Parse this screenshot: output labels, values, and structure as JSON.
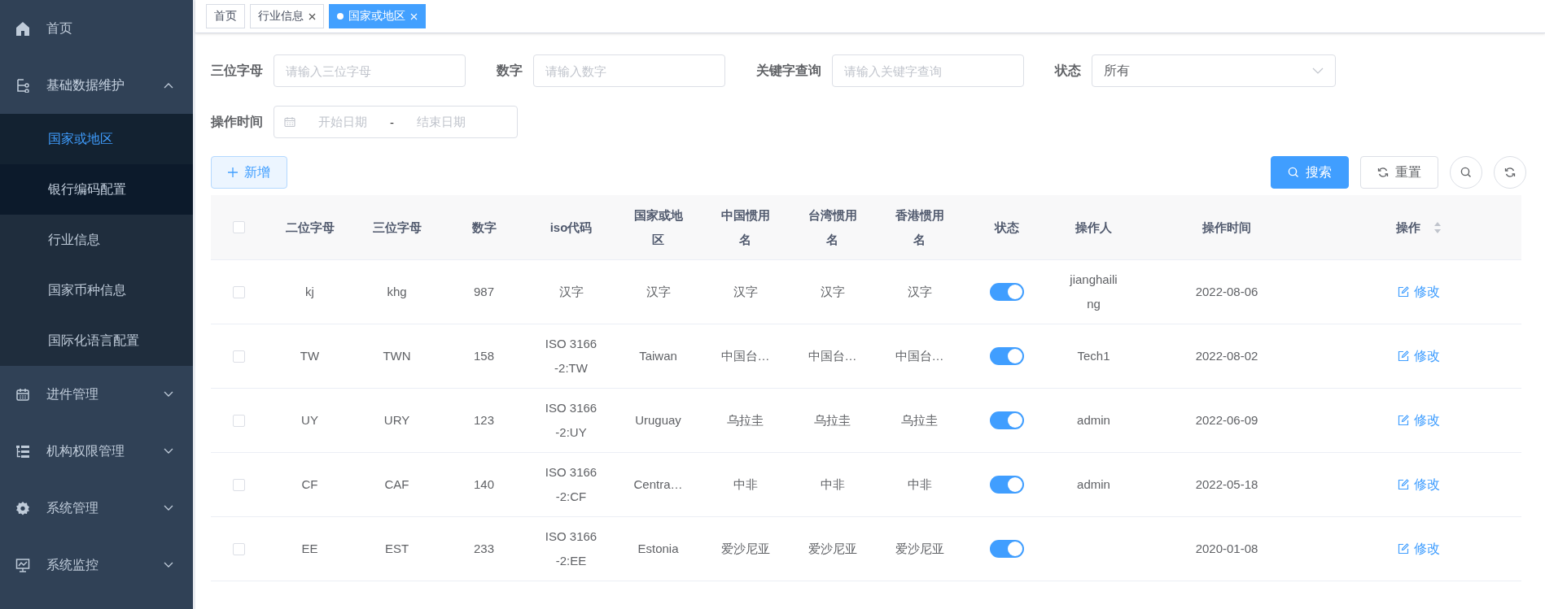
{
  "sidebar": {
    "items": [
      {
        "label": "首页"
      },
      {
        "label": "基础数据维护",
        "expanded": true,
        "children": [
          {
            "label": "国家或地区",
            "selected": true,
            "hovered": false
          },
          {
            "label": "银行编码配置",
            "selected": false,
            "hovered": true
          },
          {
            "label": "行业信息",
            "selected": false,
            "hovered": false
          },
          {
            "label": "国家币种信息",
            "selected": false,
            "hovered": false
          },
          {
            "label": "国际化语言配置",
            "selected": false,
            "hovered": false
          }
        ]
      },
      {
        "label": "进件管理",
        "expanded": false
      },
      {
        "label": "机构权限管理",
        "expanded": false
      },
      {
        "label": "系统管理",
        "expanded": false
      },
      {
        "label": "系统监控",
        "expanded": false
      }
    ]
  },
  "tabs": [
    {
      "label": "首页",
      "selected": false,
      "closable": false
    },
    {
      "label": "行业信息",
      "selected": false,
      "closable": true
    },
    {
      "label": "国家或地区",
      "selected": true,
      "closable": true
    }
  ],
  "filters": [
    {
      "label": "三位字母",
      "kind": "input",
      "placeholder": "请输入三位字母"
    },
    {
      "label": "数字",
      "kind": "input",
      "placeholder": "请输入数字"
    },
    {
      "label": "关键字查询",
      "kind": "input",
      "placeholder": "请输入关键字查询"
    },
    {
      "label": "状态",
      "kind": "select",
      "value": "所有"
    },
    {
      "label": "操作时间",
      "kind": "daterange",
      "start_placeholder": "开始日期",
      "separator": "-",
      "end_placeholder": "结束日期"
    }
  ],
  "buttons": {
    "add": "新增",
    "search": "搜索",
    "reset": "重置"
  },
  "table": {
    "all_checked": false,
    "columns": [
      {
        "label": "二位字母"
      },
      {
        "label": "三位字母"
      },
      {
        "label": "数字"
      },
      {
        "label": "iso代码"
      },
      {
        "label": "国家或地区"
      },
      {
        "label": "中国惯用名"
      },
      {
        "label": "台湾惯用名"
      },
      {
        "label": "香港惯用名"
      },
      {
        "label": "状态"
      },
      {
        "label": "操作人"
      },
      {
        "label": "操作时间"
      },
      {
        "label": "操作",
        "sortable": true
      }
    ],
    "rows": [
      {
        "checked": false,
        "cells": [
          "kj",
          "khg",
          "987",
          "汉字",
          "汉字",
          "汉字",
          "汉字",
          "汉字"
        ],
        "on": true,
        "operator": "jianghailing",
        "time": "2022-08-06",
        "action": "修改"
      },
      {
        "checked": false,
        "cells": [
          "TW",
          "TWN",
          "158",
          "ISO 3166-2:TW",
          "Taiwan",
          "中国台…",
          "中国台…",
          "中国台…"
        ],
        "on": true,
        "operator": "Tech1",
        "time": "2022-08-02",
        "action": "修改"
      },
      {
        "checked": false,
        "cells": [
          "UY",
          "URY",
          "123",
          "ISO 3166-2:UY",
          "Uruguay",
          "乌拉圭",
          "乌拉圭",
          "乌拉圭"
        ],
        "on": true,
        "operator": "admin",
        "time": "2022-06-09",
        "action": "修改"
      },
      {
        "checked": false,
        "cells": [
          "CF",
          "CAF",
          "140",
          "ISO 3166-2:CF",
          "Centra…",
          "中非",
          "中非",
          "中非"
        ],
        "on": true,
        "operator": "admin",
        "time": "2022-05-18",
        "action": "修改"
      },
      {
        "checked": false,
        "cells": [
          "EE",
          "EST",
          "233",
          "ISO 3166-2:EE",
          "Estonia",
          "爱沙尼亚",
          "爱沙尼亚",
          "爱沙尼亚"
        ],
        "on": true,
        "operator": "",
        "time": "2020-01-08",
        "action": "修改"
      }
    ]
  }
}
